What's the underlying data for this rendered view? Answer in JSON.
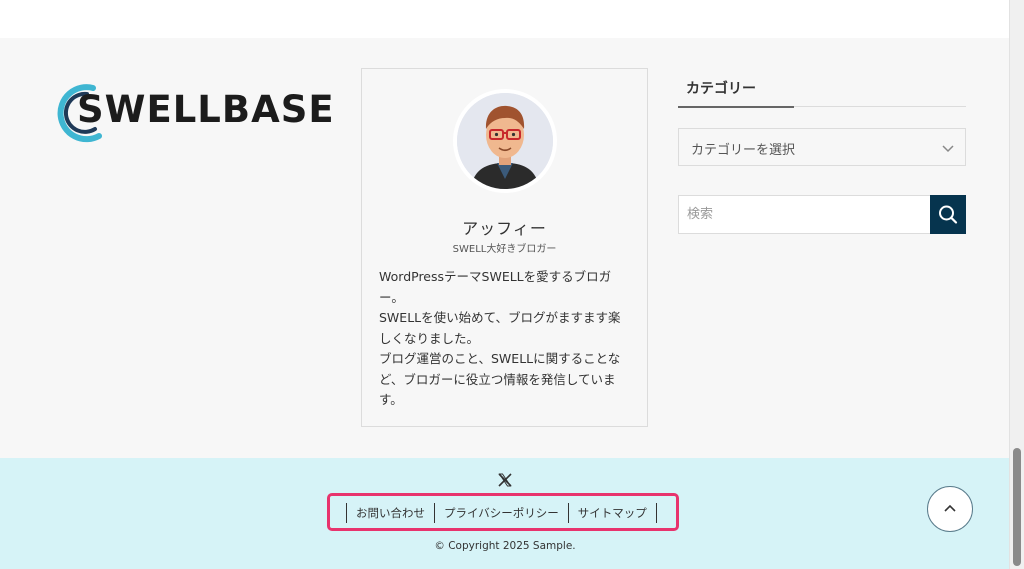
{
  "logo": {
    "text": "SWELLBASE"
  },
  "profile": {
    "name": "アッフィー",
    "role": "SWELL大好きブロガー",
    "bio_lines": [
      "WordPressテーマSWELLを愛するブロガ",
      "ー。",
      "SWELLを使い始めて、ブログがますます楽",
      "しくなりました。",
      "ブログ運営のこと、SWELLに関することな",
      "ど、ブロガーに役立つ情報を発信していま",
      "す。"
    ]
  },
  "category_widget": {
    "title": "カテゴリー",
    "select_value": "カテゴリーを選択"
  },
  "search": {
    "placeholder": "検索"
  },
  "footer": {
    "social_icon": "x-icon",
    "links": [
      "お問い合わせ",
      "プライバシーポリシー",
      "サイトマップ"
    ],
    "copyright": "© Copyright 2025 Sample."
  },
  "colors": {
    "footer_bg": "#d6f3f7",
    "search_button": "#06344e",
    "highlight": "#e8336d",
    "logo_arc_light": "#3fb6d2",
    "logo_arc_dark": "#1f3a58"
  },
  "icons": {
    "search": "search-icon",
    "chevron": "chevron-down-icon",
    "back_to_top": "chevron-up-icon"
  }
}
